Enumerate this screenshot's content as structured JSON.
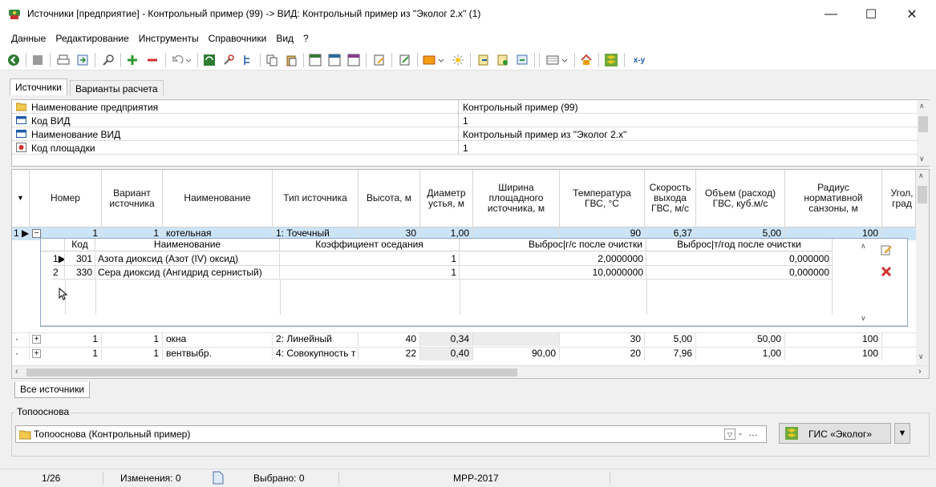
{
  "window": {
    "title": "Источники [предприятие] - Контрольный пример (99) -> ВИД: Контрольный пример из \"Эколог  2.x\" (1)",
    "minimize": "—",
    "maximize": "☐",
    "close": "✕"
  },
  "menu": [
    "Данные",
    "Редактирование",
    "Инструменты",
    "Справочники",
    "Вид",
    "?"
  ],
  "toolbar": {
    "xy_label": "x-y"
  },
  "tabs": {
    "sources": "Источники",
    "variants": "Варианты расчета"
  },
  "properties": [
    {
      "label": "Наименование предприятия",
      "value": "Контрольный пример (99)",
      "icon": "folder-icon"
    },
    {
      "label": "Код ВИД",
      "value": "1",
      "icon": "card-icon"
    },
    {
      "label": "Наименование ВИД",
      "value": "Контрольный пример из \"Эколог  2.x\"",
      "icon": "card-icon"
    },
    {
      "label": "Код площадки",
      "value": "1",
      "icon": "site-icon"
    }
  ],
  "grid": {
    "headers": {
      "num": "Номер",
      "variant": "Вариант источника",
      "name": "Наименование",
      "type": "Тип источника",
      "height": "Высота, м",
      "diam": "Диаметр устья, м",
      "width": "Ширина площадного источника, м",
      "temp": "Температура ГВС, °С",
      "speed": "Скорость выхода ГВС, м/с",
      "volume": "Объем (расход) ГВС, куб.м/с",
      "radius": "Радиус нормативной санзоны, м",
      "angle": "Угол, град"
    },
    "rows": [
      {
        "rownum": "1",
        "num": "1",
        "variant": "1",
        "name": "котельная",
        "type": "1: Точечный",
        "height": "30",
        "diam": "1,00",
        "width": "",
        "temp": "90",
        "speed": "6,37",
        "volume": "5,00",
        "radius": "100"
      },
      {
        "rownum": "",
        "num": "1",
        "variant": "1",
        "name": "окна",
        "type": "2: Линейный",
        "height": "40",
        "diam": "0,34",
        "width": "",
        "temp": "30",
        "speed": "5,00",
        "volume": "50,00",
        "radius": "100"
      },
      {
        "rownum": "",
        "num": "1",
        "variant": "1",
        "name": "вентвыбр.",
        "type": "4: Совокупность т",
        "height": "22",
        "diam": "0,40",
        "width": "90,00",
        "temp": "20",
        "speed": "7,96",
        "volume": "1,00",
        "radius": "100"
      }
    ]
  },
  "nested": {
    "headers": {
      "code": "Код",
      "name": "Наименование",
      "coef": "Коэффициент оседания",
      "gs": "Выброс|г/с после очистки",
      "ty": "Выброс|т/год после очистки"
    },
    "rows": [
      {
        "rownum": "1",
        "code": "301",
        "name": "Азота диоксид (Азот (IV) оксид)",
        "coef": "1",
        "gs": "2,0000000",
        "ty": "0,000000"
      },
      {
        "rownum": "2",
        "code": "330",
        "name": "Сера диоксид (Ангидрид сернистый)",
        "coef": "1",
        "gs": "10,0000000",
        "ty": "0,000000"
      }
    ]
  },
  "bottom_tab": "Все источники",
  "topo": {
    "group_label": "Топооснова",
    "value": "Топооснова (Контрольный пример)",
    "gis_label": "ГИС «Эколог»"
  },
  "status": {
    "position": "1/26",
    "changes": "Изменения: 0",
    "selected": "Выбрано: 0",
    "method": "МРР-2017"
  }
}
